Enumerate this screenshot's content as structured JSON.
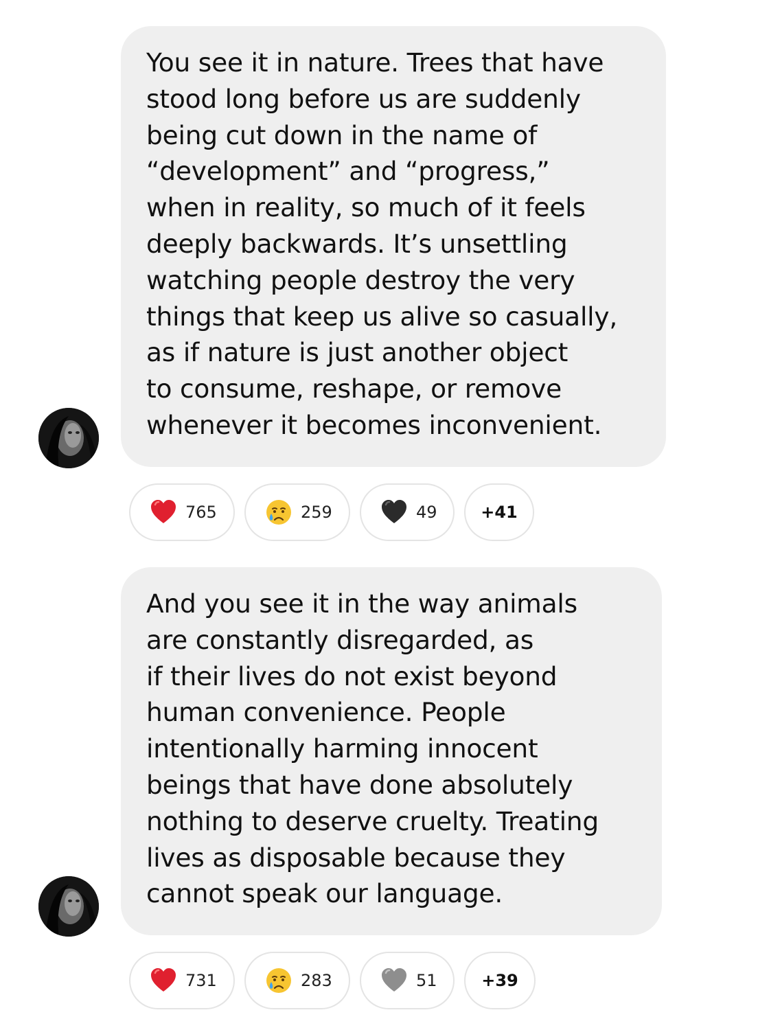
{
  "messages": [
    {
      "lines": [
        "You see it in nature. Trees that have",
        "stood long before us are suddenly",
        "being cut down in the name of",
        "“development” and “progress,”",
        "when in reality, so much of it feels",
        "deeply backwards. It’s unsettling",
        "watching people destroy the very",
        "things that keep us alive so casually,",
        "as if nature is just another object",
        "to consume, reshape, or remove",
        "whenever it becomes inconvenient."
      ],
      "reactions": [
        {
          "emoji": "red-heart-icon",
          "count": "765"
        },
        {
          "emoji": "crying-face-icon",
          "count": "259"
        },
        {
          "emoji": "black-heart-icon",
          "count": "49"
        }
      ],
      "more": "+41"
    },
    {
      "lines": [
        "And you see it in the way animals",
        "are constantly disregarded, as",
        "if their lives do not exist beyond",
        "human convenience. People",
        "intentionally harming innocent",
        "beings that have done absolutely",
        "nothing to deserve cruelty. Treating",
        "lives as disposable because they",
        "cannot speak our language."
      ],
      "reactions": [
        {
          "emoji": "red-heart-icon",
          "count": "731"
        },
        {
          "emoji": "crying-face-icon",
          "count": "283"
        },
        {
          "emoji": "grey-heart-icon",
          "count": "51"
        }
      ],
      "more": "+39"
    }
  ],
  "colors": {
    "bubble": "#efefef",
    "pill_border": "#e4e4e4",
    "red_heart": "#e0202f",
    "black_heart": "#2b2b2b",
    "grey_heart": "#8e8e8e",
    "emoji_face": "#f7c531"
  }
}
